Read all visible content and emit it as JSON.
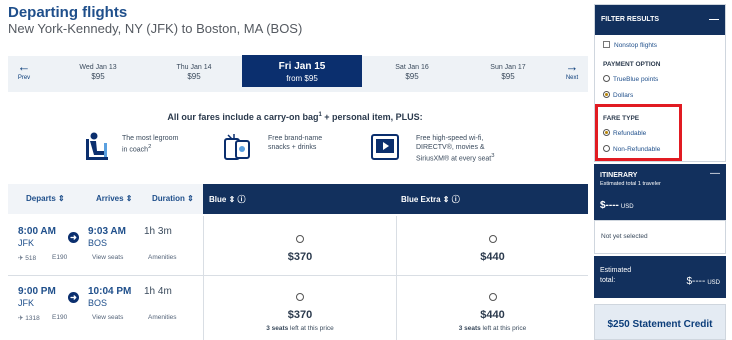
{
  "header": {
    "title": "Departing flights",
    "route": "New York-Kennedy, NY (JFK) to Boston, MA (BOS)"
  },
  "date_bar": {
    "prev_label": "Prev",
    "next_label": "Next",
    "dates": [
      {
        "date": "Wed Jan 13",
        "price": "$95"
      },
      {
        "date": "Thu Jan 14",
        "price": "$95"
      },
      {
        "date": "Fri Jan 15",
        "price": "from $95",
        "selected": true
      },
      {
        "date": "Sat Jan 16",
        "price": "$95"
      },
      {
        "date": "Sun Jan 17",
        "price": "$95"
      }
    ]
  },
  "promo": {
    "headline_a": "All our fares include a carry-on bag",
    "headline_sup": "1",
    "headline_b": " + personal item, PLUS:",
    "items": [
      {
        "icon": "legroom-seat-icon",
        "line1": "The most legroom",
        "line2": "in coach",
        "sup": "2"
      },
      {
        "icon": "snacks-icon",
        "line1": "Free brand-name",
        "line2": "snacks + drinks"
      },
      {
        "icon": "tv-wifi-icon",
        "line1": "Free high-speed wi-fi,",
        "line2": "DIRECTV®, movies &",
        "line3": "SiriusXM® at every seat",
        "sup": "3"
      }
    ]
  },
  "table": {
    "col_departs": "Departs",
    "col_arrives": "Arrives",
    "col_duration": "Duration",
    "col_blue": "Blue",
    "col_blue_extra": "Blue Extra",
    "rows": [
      {
        "depart_time": "8:00 AM",
        "depart_code": "JFK",
        "arrive_time": "9:03 AM",
        "arrive_code": "BOS",
        "duration": "1h 3m",
        "flight": "518",
        "aircraft": "E190",
        "view_seats": "View seats",
        "amenities": "Amenities",
        "blue_price": "$370",
        "blue_extra_price": "$440",
        "blue_seats": "",
        "blue_extra_seats": ""
      },
      {
        "depart_time": "9:00 PM",
        "depart_code": "JFK",
        "arrive_time": "10:04 PM",
        "arrive_code": "BOS",
        "duration": "1h 4m",
        "flight": "1318",
        "aircraft": "E190",
        "view_seats": "View seats",
        "amenities": "Amenities",
        "blue_price": "$370",
        "blue_extra_price": "$440",
        "blue_seats_n": "3 seats",
        "blue_seats_rest": " left at this price",
        "blue_extra_seats_n": "3 seats",
        "blue_extra_seats_rest": " left at this price"
      }
    ]
  },
  "sidebar": {
    "filter_title": "FILTER RESULTS",
    "nonstop": "Nonstop flights",
    "payment_label": "PAYMENT OPTION",
    "payment_options": [
      "TrueBlue points",
      "Dollars"
    ],
    "payment_selected": "Dollars",
    "fare_label": "FARE TYPE",
    "fare_options": [
      "Refundable",
      "Non-Refundable"
    ],
    "fare_selected": "Refundable",
    "itinerary_title": "ITINERARY",
    "itinerary_sub": "Estimated total 1 traveler",
    "amount": "$----",
    "currency": "USD",
    "not_selected": "Not yet selected",
    "estimated_l1": "Estimated",
    "estimated_l2": "total:",
    "credit": "$250 Statement Credit"
  },
  "colors": {
    "navy": "#12305d",
    "link_blue": "#1f4f8b",
    "highlight_red": "#e11b22"
  }
}
